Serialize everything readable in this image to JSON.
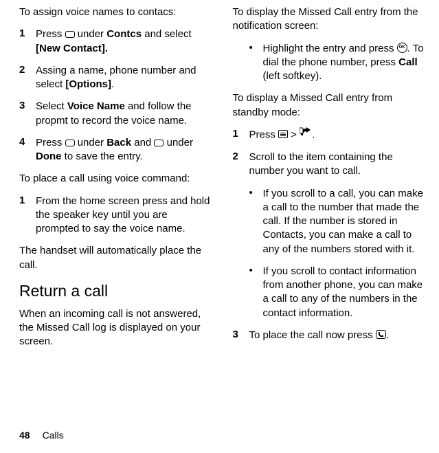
{
  "col1": {
    "intro": "To assign voice names to contacs:",
    "steps": [
      {
        "n": "1",
        "pre": "Press ",
        "icon": "softkey",
        "post1": " under ",
        "b1": "Contcs",
        "post2": " and select ",
        "b2": "[New Contact]."
      },
      {
        "n": "2",
        "text": "Assing a name, phone number and select ",
        "b1": "[Options]",
        "post": "."
      },
      {
        "n": "3",
        "pre": "Select ",
        "b1": "Voice Name",
        "post": " and follow the propmt to record the voice name."
      },
      {
        "n": "4",
        "pre": "Press ",
        "icon1": "softkey",
        "mid1": " under ",
        "b1": "Back",
        "mid2": " and ",
        "icon2": "softkey",
        "mid3": " under ",
        "b2": "Done",
        "post": " to save the entry."
      }
    ],
    "intro2": "To place a call using voice command:",
    "steps2": [
      {
        "n": "1",
        "text": "From the home screen press and hold the speaker key until you are prompted to say the voice name."
      }
    ],
    "outro": "The handset will automatically place the call.",
    "heading": "Return a call",
    "para2": "When an incoming call is not answered, the Missed Call log is displayed on your screen."
  },
  "col2": {
    "intro": "To display the Missed Call entry from the notification screen:",
    "bullet1": {
      "pre": "Highlight the entry and press ",
      "icon": "ok",
      "post1": ". To dial the phone number, press ",
      "b1": "Call",
      "post2": " (left softkey)."
    },
    "intro2": "To display a Missed Call entry from standby mode:",
    "steps": [
      {
        "n": "1",
        "pre": "Press ",
        "icon1": "menu",
        "mid": " > ",
        "icon2": "recent",
        "post": "."
      },
      {
        "n": "2",
        "text": "Scroll to the item containing the number you want to call."
      }
    ],
    "bullets2": [
      "If you scroll to a call, you can make a call to the number that made the call. If the number is stored in Contacts, you can make a call to any of the numbers stored with it.",
      "If you scroll to contact information from another phone, you can make a call to any of the numbers in the contact information."
    ],
    "step3": {
      "n": "3",
      "pre": "To place the call now press ",
      "icon": "call",
      "post": "."
    }
  },
  "footer": {
    "page": "48",
    "section": "Calls"
  }
}
